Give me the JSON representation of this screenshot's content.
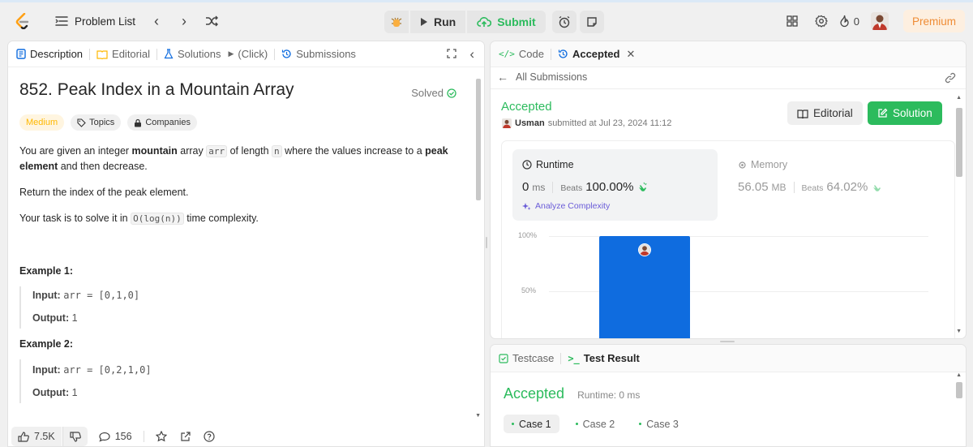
{
  "nav": {
    "problem_list": "Problem List",
    "run": "Run",
    "submit": "Submit",
    "streak": "0",
    "premium": "Premium"
  },
  "desc_tabs": {
    "description": "Description",
    "editorial": "Editorial",
    "solutions": "Solutions",
    "click": "(Click)",
    "submissions": "Submissions"
  },
  "problem": {
    "title": "852. Peak Index in a Mountain Array",
    "solved": "Solved",
    "difficulty": "Medium",
    "topics": "Topics",
    "companies": "Companies",
    "p1_a": "You are given an integer ",
    "p1_b": "mountain",
    "p1_c": " array ",
    "p1_code1": "arr",
    "p1_d": " of length ",
    "p1_code2": "n",
    "p1_e": " where the values increase to a ",
    "p1_f": "peak element",
    "p1_g": " and then decrease.",
    "p2": "Return the index of the peak element.",
    "p3_a": "Your task is to solve it in ",
    "p3_code": "O(log(n))",
    "p3_b": " time complexity.",
    "ex1_title": "Example 1:",
    "ex2_title": "Example 2:",
    "input_label": "Input:",
    "output_label": "Output:",
    "ex1_input": "arr = [0,1,0]",
    "ex1_output": "1",
    "ex2_input": "arr = [0,2,1,0]",
    "ex2_output": "1"
  },
  "footer": {
    "likes": "7.5K",
    "comments": "156"
  },
  "code_tabs": {
    "code": "Code",
    "accepted": "Accepted"
  },
  "submission": {
    "all": "All Submissions",
    "status": "Accepted",
    "user": "Usman",
    "submitted": "submitted at Jul 23, 2024 11:12",
    "editorial_btn": "Editorial",
    "solution_btn": "Solution",
    "runtime_label": "Runtime",
    "runtime_value": "0",
    "runtime_unit": "ms",
    "beats": "Beats",
    "runtime_beats": "100.00%",
    "analyze": "Analyze Complexity",
    "memory_label": "Memory",
    "memory_value": "56.05",
    "memory_unit": "MB",
    "memory_beats": "64.02%"
  },
  "chart_data": {
    "type": "bar",
    "yticks": [
      "100%",
      "50%"
    ],
    "ylim": [
      0,
      100
    ],
    "bar_value": 100,
    "bar_color": "#0f6cdf"
  },
  "bottom_tabs": {
    "testcase": "Testcase",
    "test_result": "Test Result"
  },
  "result": {
    "status": "Accepted",
    "runtime": "Runtime: 0 ms",
    "cases": [
      "Case 1",
      "Case 2",
      "Case 3"
    ]
  },
  "colors": {
    "accent_green": "#2cbb5d",
    "orange": "#ffa116",
    "blue": "#0f6cdf"
  }
}
